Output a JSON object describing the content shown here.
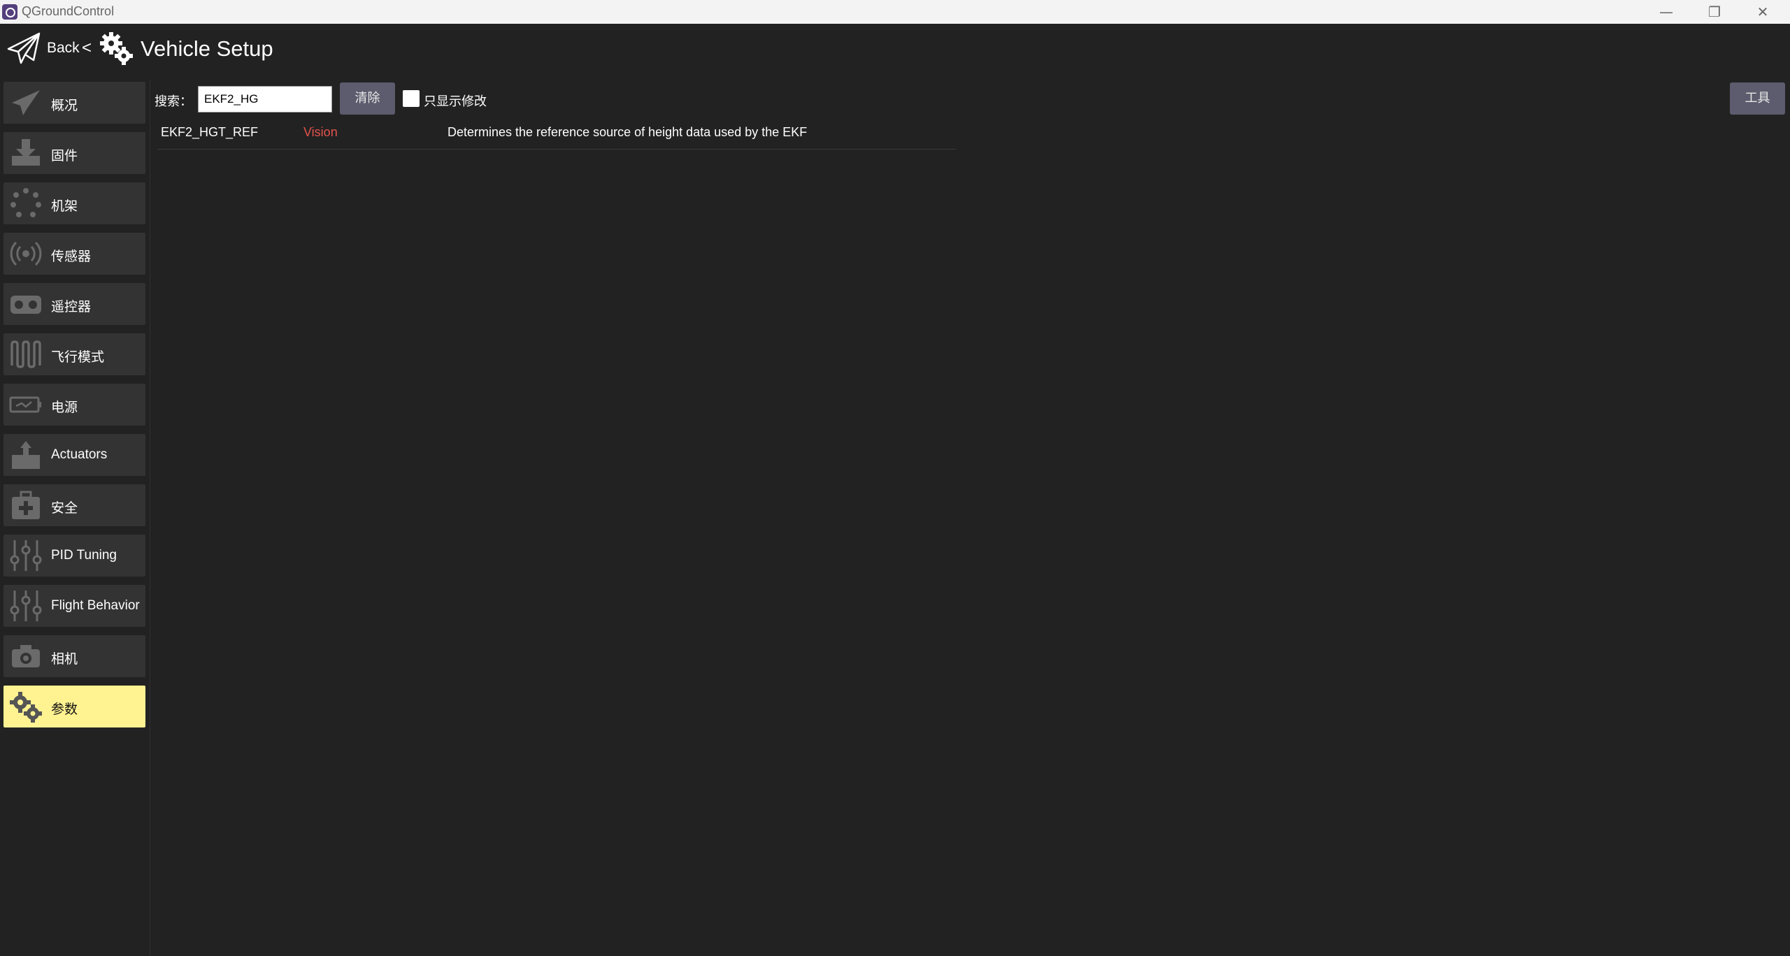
{
  "window": {
    "title": "QGroundControl",
    "minimize": "—",
    "maximize": "❐",
    "close": "✕"
  },
  "header": {
    "back_label": "Back",
    "separator": "<",
    "title": "Vehicle Setup"
  },
  "sidebar": {
    "items": [
      {
        "label": "概况",
        "icon": "paper-plane-icon",
        "active": false
      },
      {
        "label": "固件",
        "icon": "download-tray-icon",
        "active": false
      },
      {
        "label": "机架",
        "icon": "airframe-dots-icon",
        "active": false
      },
      {
        "label": "传感器",
        "icon": "sensor-signal-icon",
        "active": false
      },
      {
        "label": "遥控器",
        "icon": "radio-controller-icon",
        "active": false
      },
      {
        "label": "飞行模式",
        "icon": "wave-icon",
        "active": false
      },
      {
        "label": "电源",
        "icon": "battery-icon",
        "active": false
      },
      {
        "label": "Actuators",
        "icon": "actuator-icon",
        "active": false
      },
      {
        "label": "安全",
        "icon": "first-aid-kit-icon",
        "active": false
      },
      {
        "label": "PID Tuning",
        "icon": "sliders-icon",
        "active": false
      },
      {
        "label": "Flight Behavior",
        "icon": "sliders-icon",
        "active": false
      },
      {
        "label": "相机",
        "icon": "camera-icon",
        "active": false
      },
      {
        "label": "参数",
        "icon": "gears-icon",
        "active": true
      }
    ]
  },
  "search": {
    "label": "搜索：",
    "value": "EKF2_HG",
    "clear_label": "清除",
    "modified_only_label": "只显示修改",
    "modified_only_checked": false
  },
  "tools_label": "工具",
  "params": [
    {
      "name": "EKF2_HGT_REF",
      "value": "Vision",
      "description": "Determines the reference source of height data used by the EKF"
    }
  ],
  "colors": {
    "background": "#222222",
    "sidebar_button": "#333333",
    "active": "#fff291",
    "modified_value": "#e4524c",
    "button": "#5c5c6e"
  }
}
